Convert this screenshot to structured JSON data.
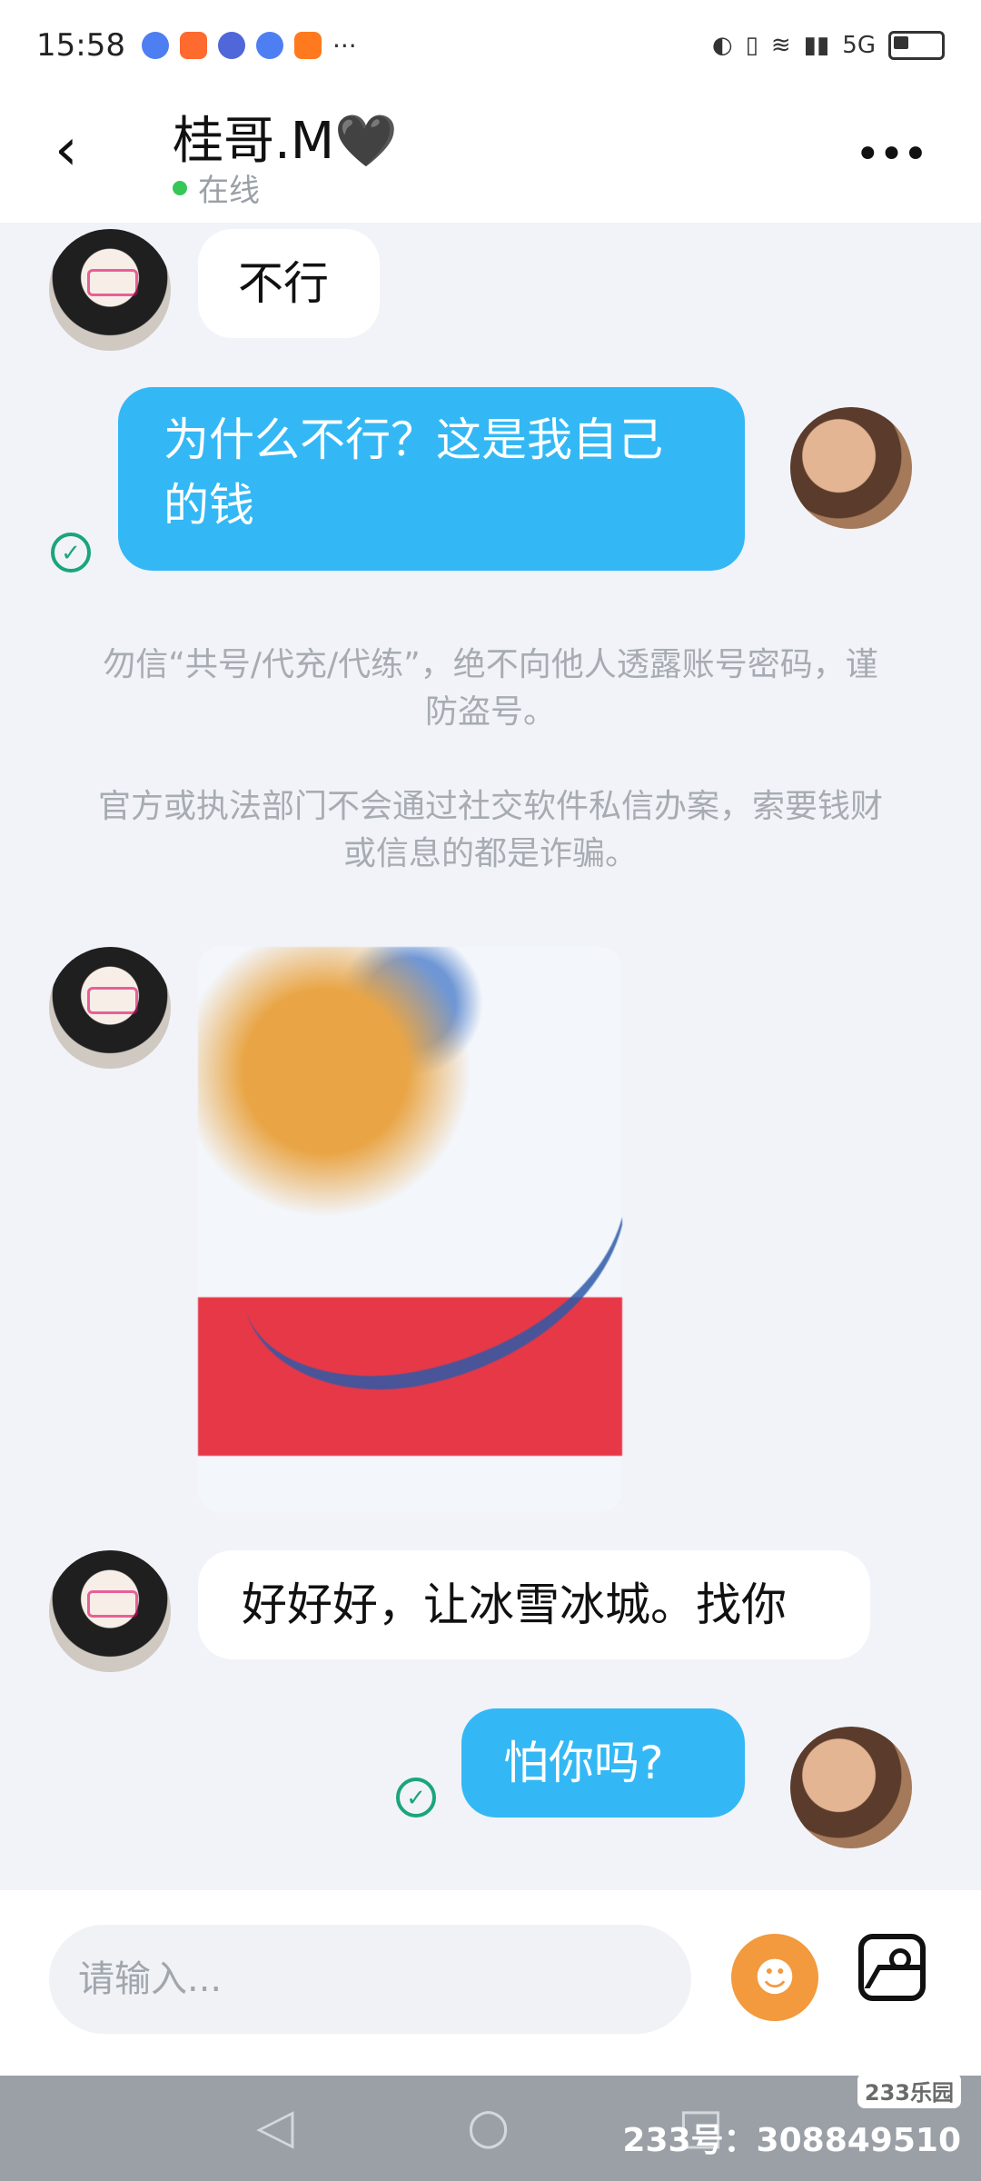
{
  "status_bar": {
    "time": "15:58",
    "icons": [
      "browser-icon",
      "233-app-icon",
      "music-icon",
      "browser-icon",
      "home-icon",
      "more-icon"
    ],
    "network": "5G"
  },
  "header": {
    "title": "桂哥.M🖤",
    "online_status": "在线"
  },
  "messages": [
    {
      "side": "in",
      "text": "不行"
    },
    {
      "side": "out",
      "text": "为什么不行？这是我自己的钱"
    },
    {
      "side": "system",
      "text": "勿信“共号/代充/代练”，绝不向他人透露账号密码，谨防盗号。"
    },
    {
      "side": "system",
      "text": "官方或执法部门不会通过社交软件私信办案，索要钱财或信息的都是诈骗。"
    },
    {
      "side": "in",
      "type": "image"
    },
    {
      "side": "in",
      "text": "好好好，让冰雪冰城。找你"
    },
    {
      "side": "out",
      "text": "怕你吗?"
    }
  ],
  "composer": {
    "placeholder": "请输入..."
  },
  "navigation": {
    "back": "◁",
    "home": "○",
    "recent": "□"
  },
  "watermark": {
    "brand": "233乐园",
    "id_text": "233号：308849510"
  }
}
